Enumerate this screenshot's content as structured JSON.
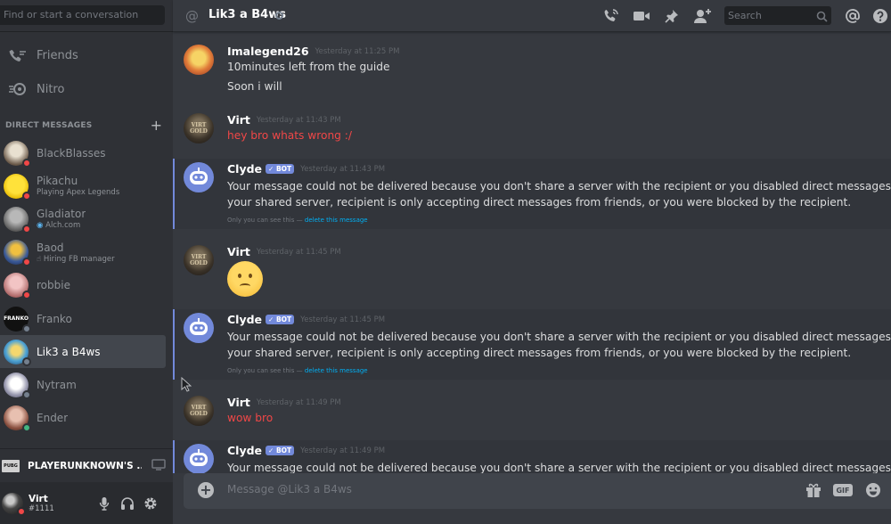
{
  "sidebar": {
    "search_placeholder": "Find or start a conversation",
    "nav": [
      {
        "label": "Friends"
      },
      {
        "label": "Nitro"
      }
    ],
    "dm_header": "DIRECT MESSAGES",
    "dms": [
      {
        "name": "BlackBlasses",
        "status": "dnd",
        "sub": ""
      },
      {
        "name": "Pikachu",
        "status": "dnd",
        "sub": "Playing Apex Legends"
      },
      {
        "name": "Gladiator",
        "status": "dnd",
        "sub": "Alch.com"
      },
      {
        "name": "Baod",
        "status": "dnd",
        "sub": "Hiring FB manager"
      },
      {
        "name": "robbie",
        "status": "dnd",
        "sub": ""
      },
      {
        "name": "Franko",
        "status": "idle",
        "sub": ""
      },
      {
        "name": "Lik3 a B4ws",
        "status": "idle",
        "sub": "",
        "selected": true
      },
      {
        "name": "Nytram",
        "status": "idle",
        "sub": ""
      },
      {
        "name": "Ender",
        "status": "online",
        "sub": ""
      }
    ],
    "game": {
      "icon_text": "PUBG",
      "title": "PLAYERUNKNOWN'S ..."
    },
    "user": {
      "name": "Virt",
      "tag": "#1111"
    }
  },
  "header": {
    "channel_name": "Lik3 a B4ws",
    "search_placeholder": "Search"
  },
  "messages": [
    {
      "author": "Imalegend26",
      "time": "Yesterday at 11:25 PM",
      "lines": [
        "10minutes left from the guide",
        "Soon i will"
      ]
    },
    {
      "author": "Virt",
      "time": "Yesterday at 11:43 PM",
      "lines": [
        "hey bro whats wrong :/"
      ],
      "color": "red"
    },
    {
      "author": "Clyde",
      "bot": "BOT",
      "time": "Yesterday at 11:43 PM",
      "lines": [
        "Your message could not be delivered because you don't share a server with the recipient or you disabled direct messages on",
        "your shared server, recipient is only accepting direct messages from friends, or you were blocked by the recipient."
      ],
      "ephemeral": "Only you can see this —",
      "ephemeral_link": "delete this message"
    },
    {
      "author": "Virt",
      "time": "Yesterday at 11:45 PM",
      "emoji": "frowning-face"
    },
    {
      "author": "Clyde",
      "bot": "BOT",
      "time": "Yesterday at 11:45 PM",
      "lines": [
        "Your message could not be delivered because you don't share a server with the recipient or you disabled direct messages on",
        "your shared server, recipient is only accepting direct messages from friends, or you were blocked by the recipient."
      ],
      "ephemeral": "Only you can see this —",
      "ephemeral_link": "delete this message"
    },
    {
      "author": "Virt",
      "time": "Yesterday at 11:49 PM",
      "lines": [
        "wow bro"
      ],
      "color": "red"
    },
    {
      "author": "Clyde",
      "bot": "BOT",
      "time": "Yesterday at 11:49 PM",
      "lines": [
        "Your message could not be delivered because you don't share a server with the recipient or you disabled direct messages on"
      ]
    }
  ],
  "avatar_labels": {
    "virt": "VIRT\nGOLD",
    "franko": "FRANKO"
  },
  "composer": {
    "placeholder": "Message @Lik3 a B4ws",
    "gif_label": "GIF"
  },
  "colors": {
    "accent": "#7289da",
    "dnd": "#f04747",
    "online": "#43b581",
    "idle": "#747f8d",
    "red_text": "#f04747",
    "link": "#00b0f4"
  }
}
